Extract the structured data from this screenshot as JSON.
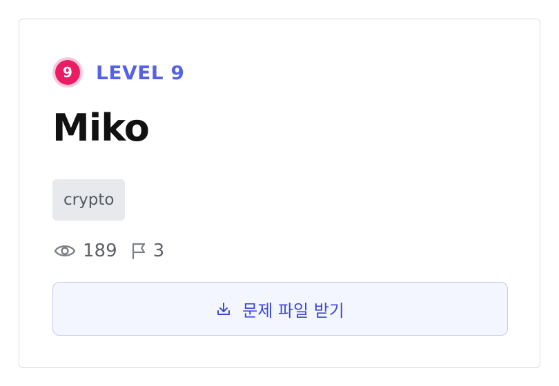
{
  "challenge": {
    "level_number": "9",
    "level_label": "LEVEL 9",
    "title": "Miko",
    "tag": "crypto",
    "views": "189",
    "solves": "3",
    "download_label": "문제 파일 받기"
  },
  "icons": {
    "views": "eye-icon",
    "solves": "flag-icon",
    "download": "download-icon"
  },
  "colors": {
    "level_badge": "#ea1c63",
    "level_badge_ring": "#f6c8dc",
    "level_text": "#5661e8",
    "title_text": "#111111",
    "tag_bg": "#e7e9ec",
    "button_bg": "#f3f5ff",
    "button_border": "#c4c9ee",
    "button_text": "#3c48d8"
  }
}
